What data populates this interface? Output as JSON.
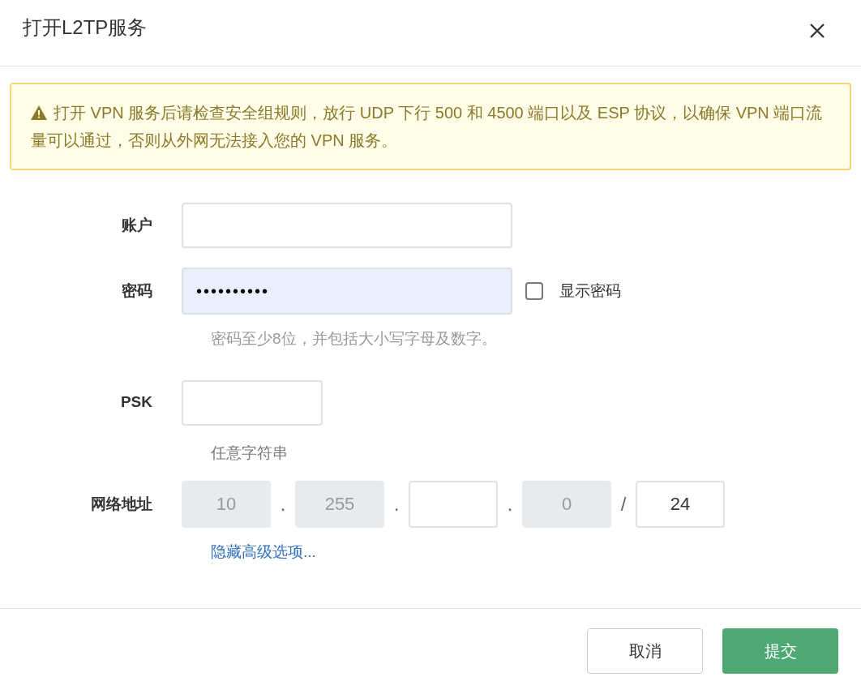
{
  "dialog": {
    "title": "打开L2TP服务"
  },
  "warning": {
    "text": "打开 VPN 服务后请检查安全组规则，放行 UDP 下行 500 和 4500 端口以及 ESP 协议，以确保 VPN 端口流量可以通过，否则从外网无法接入您的 VPN 服务。"
  },
  "account": {
    "label": "账户"
  },
  "password": {
    "label": "密码",
    "value": "••••••••••",
    "autofilled": true,
    "show_password": {
      "label": "显示密码",
      "checked": false
    },
    "hint": "密码至少8位，并包括大小写字母及数字。"
  },
  "psk": {
    "label": "PSK",
    "hint": "任意字符串"
  },
  "network": {
    "label": "网络地址",
    "segments": [
      {
        "value": "10",
        "disabled": true,
        "separator": "."
      },
      {
        "value": "255",
        "disabled": true,
        "separator": "."
      },
      {
        "disabled": false,
        "separator": "."
      },
      {
        "value": "0",
        "disabled": true,
        "separator": "/"
      },
      {
        "value": "24",
        "disabled": false
      }
    ],
    "toggle_link": "隐藏高级选项..."
  },
  "buttons": [
    {
      "label": "取消",
      "kind": "secondary"
    },
    {
      "label": "提交",
      "kind": "primary"
    }
  ]
}
